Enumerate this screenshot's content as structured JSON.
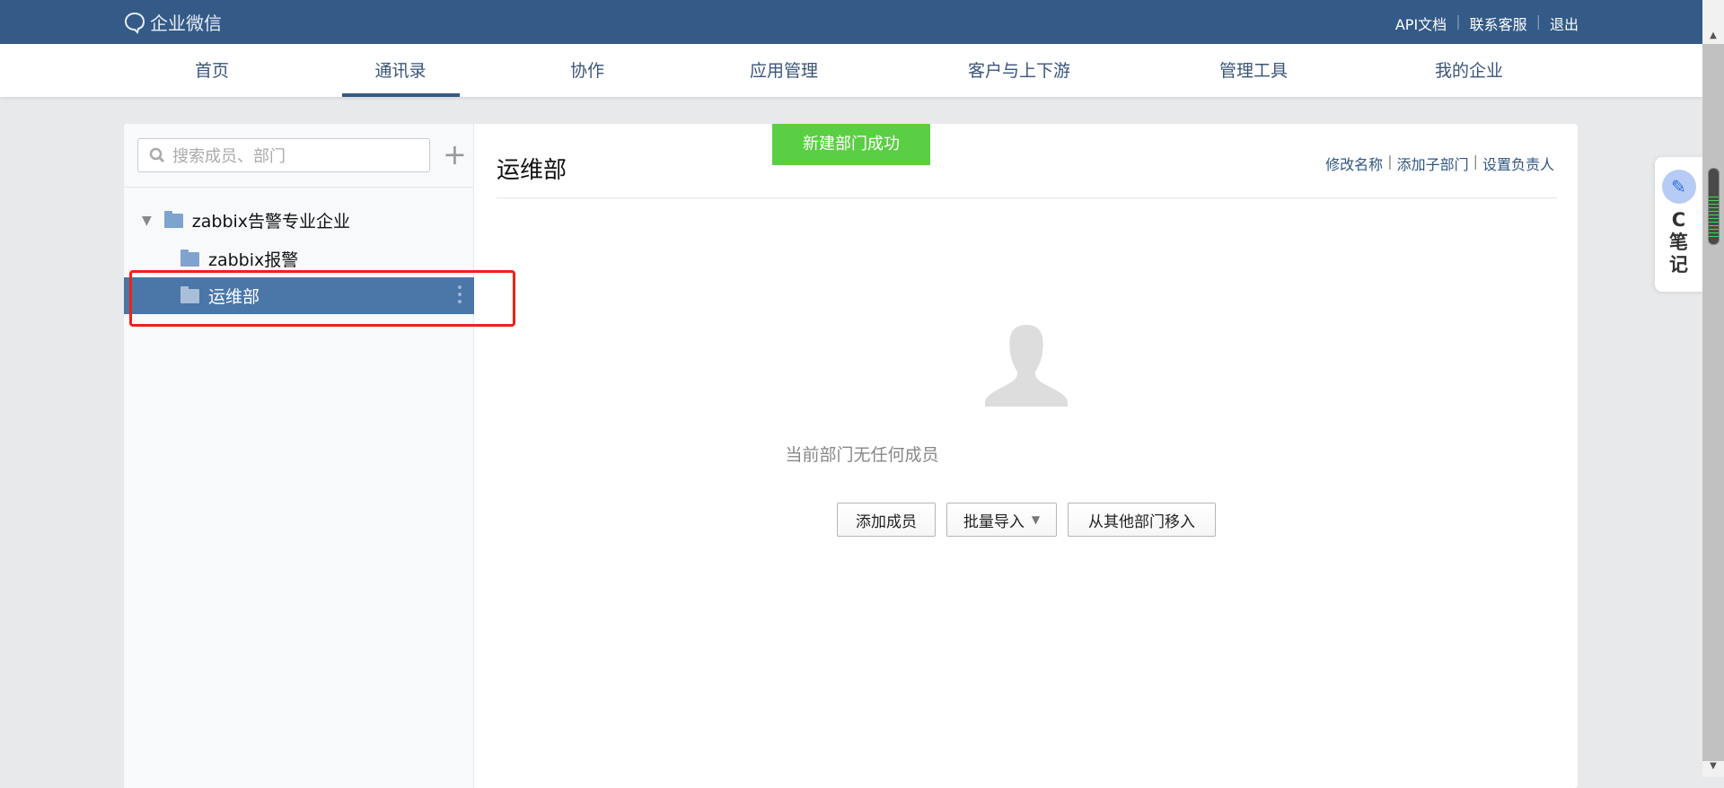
{
  "header": {
    "logo_text": "企业微信",
    "links": [
      "API文档",
      "联系客服",
      "退出"
    ]
  },
  "nav": {
    "items": [
      "首页",
      "通讯录",
      "协作",
      "应用管理",
      "客户与上下游",
      "管理工具",
      "我的企业"
    ],
    "active": "通讯录"
  },
  "sidebar": {
    "search_placeholder": "搜索成员、部门",
    "tree": [
      {
        "label": "zabbix告警专业企业"
      },
      {
        "label": "zabbix报警"
      },
      {
        "label": "运维部"
      }
    ]
  },
  "main": {
    "title": "运维部",
    "actions": [
      "修改名称",
      "添加子部门",
      "设置负责人"
    ],
    "toast": "新建部门成功",
    "empty_text": "当前部门无任何成员",
    "buttons": {
      "add_member": "添加成员",
      "batch_import": "批量导入",
      "move_from": "从其他部门移入"
    }
  },
  "widget": {
    "label_c": "C",
    "label_1": "笔",
    "label_2": "记"
  },
  "colors": {
    "header": "#345a87",
    "selected": "#4a76a8",
    "toast": "#5bcf44",
    "highlight": "#f0201a"
  }
}
